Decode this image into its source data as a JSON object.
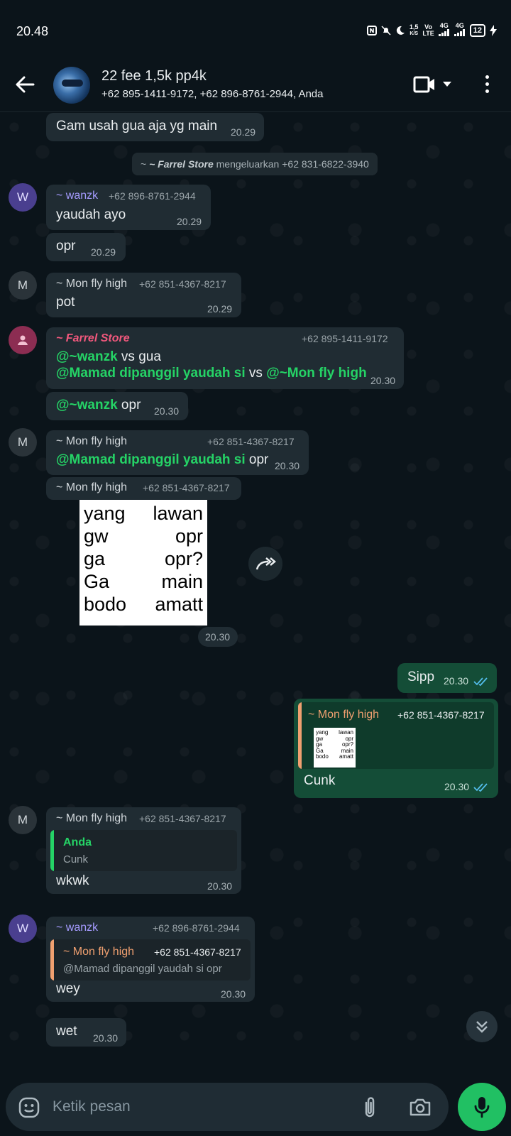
{
  "status_bar": {
    "time": "20.48",
    "net_speed_top": "1,5",
    "net_speed_unit": "K/S",
    "volte_top": "Vo",
    "volte_bottom": "LTE",
    "sig1": "4G",
    "sig2": "4G",
    "battery": "12"
  },
  "header": {
    "title": "22 fee 1,5k pp4k",
    "subtitle": "+62 895-1411-9172, +62 896-8761-2944, Anda"
  },
  "messages": {
    "m1": {
      "text": "Gam usah gua aja yg main",
      "time": "20.29"
    },
    "sys1": {
      "actor": "~ Farrel Store",
      "text": " mengeluarkan +62 831-6822-3940"
    },
    "m2": {
      "avatar": "W",
      "sender": "~ wanzk",
      "phone": "+62 896-8761-2944",
      "text": "yaudah ayo",
      "time": "20.29"
    },
    "m3": {
      "text": "opr",
      "time": "20.29"
    },
    "m4": {
      "avatar": "M",
      "sender": "~ Mon fly high",
      "phone": "+62 851-4367-8217",
      "text": "pot",
      "time": "20.29"
    },
    "m5": {
      "sender": "~ Farrel Store",
      "phone": "+62 895-1411-9172",
      "mention1": "@~wanzk",
      "text1": " vs gua",
      "mention2": "@Mamad dipanggil yaudah si",
      "text2": " vs ",
      "mention3": "@~Mon fly high",
      "time": "20.30"
    },
    "m6": {
      "mention": "@~wanzk",
      "text": " opr",
      "time": "20.30"
    },
    "m7": {
      "avatar": "M",
      "sender": "~ Mon fly high",
      "phone": "+62 851-4367-8217",
      "mention": "@Mamad dipanggil yaudah si",
      "text": " opr",
      "time": "20.30"
    },
    "m8": {
      "sender": "~ Mon fly high",
      "phone": "+62 851-4367-8217",
      "time": "20.30",
      "image_rows": [
        {
          "left": "yang",
          "right": "lawan"
        },
        {
          "left": "gw",
          "right": "opr"
        },
        {
          "left": "ga",
          "right": "opr?"
        },
        {
          "left": "Ga",
          "right": "main"
        },
        {
          "left": "bodo",
          "right": "amatt"
        }
      ]
    },
    "m9": {
      "text": "Sipp",
      "time": "20.30"
    },
    "m10": {
      "quote_sender": "~ Mon fly high",
      "quote_phone": "+62 851-4367-8217",
      "text": "Cunk",
      "time": "20.30"
    },
    "m11": {
      "avatar": "M",
      "sender": "~ Mon fly high",
      "phone": "+62 851-4367-8217",
      "quote_sender": "Anda",
      "quote_text": "Cunk",
      "text": "wkwk",
      "time": "20.30"
    },
    "m12": {
      "avatar": "W",
      "sender": "~ wanzk",
      "phone": "+62 896-8761-2944",
      "quote_sender": "~ Mon fly high",
      "quote_phone": "+62 851-4367-8217",
      "quote_text": "@Mamad dipanggil yaudah si opr",
      "text": "wey",
      "time": "20.30"
    },
    "m13": {
      "text": "wet",
      "time": "20.30"
    }
  },
  "input": {
    "placeholder": "Ketik pesan"
  },
  "colors": {
    "accent": "#21c063",
    "mention": "#25d366",
    "wanzk": "#a59bff",
    "farrel": "#f2587d",
    "mon_quote": "#f0a070",
    "read_ticks": "#53bdeb"
  }
}
